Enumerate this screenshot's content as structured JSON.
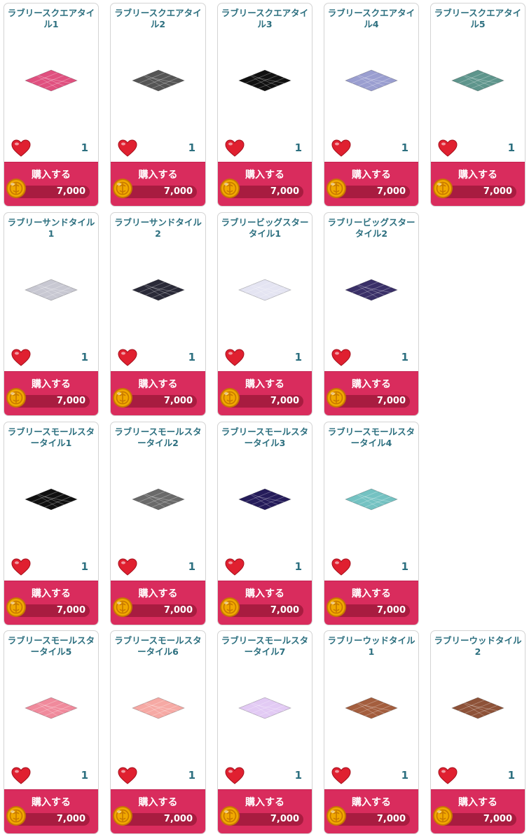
{
  "buy_label": "購入する",
  "colors": {
    "title": "#2c6f7f",
    "buy_panel": "#d92c5d",
    "price_bar": "#a81c40",
    "heart": "#e02030",
    "coin": "#f0a800"
  },
  "items": [
    {
      "name": "ラブリースクエアタイル1",
      "likes": "1",
      "price": "7,000",
      "icon": "pink-square-tile-icon",
      "tile_color": "#e0507f"
    },
    {
      "name": "ラブリースクエアタイル2",
      "likes": "1",
      "price": "7,000",
      "icon": "gray-square-tile-icon",
      "tile_color": "#555555"
    },
    {
      "name": "ラブリースクエアタイル3",
      "likes": "1",
      "price": "7,000",
      "icon": "black-square-tile-icon",
      "tile_color": "#111111"
    },
    {
      "name": "ラブリースクエアタイル4",
      "likes": "1",
      "price": "7,000",
      "icon": "lavender-square-tile-icon",
      "tile_color": "#9a9ed0"
    },
    {
      "name": "ラブリースクエアタイル5",
      "likes": "1",
      "price": "7,000",
      "icon": "teal-square-tile-icon",
      "tile_color": "#5e958c"
    },
    {
      "name": "ラブリーサンドタイル1",
      "likes": "1",
      "price": "7,000",
      "icon": "silver-sand-tile-icon",
      "tile_color": "#c8c8d2"
    },
    {
      "name": "ラブリーサンドタイル2",
      "likes": "1",
      "price": "7,000",
      "icon": "dark-sand-tile-icon",
      "tile_color": "#2a2a38"
    },
    {
      "name": "ラブリービッグスタータイル1",
      "likes": "1",
      "price": "7,000",
      "icon": "white-big-star-tile-icon",
      "tile_color": "#e4e4f2"
    },
    {
      "name": "ラブリービッグスタータイル2",
      "likes": "1",
      "price": "7,000",
      "icon": "purple-big-star-tile-icon",
      "tile_color": "#3a3068"
    },
    {
      "name": "ラブリースモールスタータイル1",
      "likes": "1",
      "price": "7,000",
      "icon": "black-small-star-tile-icon",
      "tile_color": "#111111"
    },
    {
      "name": "ラブリースモールスタータイル2",
      "likes": "1",
      "price": "7,000",
      "icon": "gray-small-star-tile-icon",
      "tile_color": "#6a6a6a"
    },
    {
      "name": "ラブリースモールスタータイル3",
      "likes": "1",
      "price": "7,000",
      "icon": "navy-small-star-tile-icon",
      "tile_color": "#251c5a"
    },
    {
      "name": "ラブリースモールスタータイル4",
      "likes": "1",
      "price": "7,000",
      "icon": "aqua-small-star-tile-icon",
      "tile_color": "#74c2c2"
    },
    {
      "name": "ラブリースモールスタータイル5",
      "likes": "1",
      "price": "7,000",
      "icon": "pink-small-star-tile-icon",
      "tile_color": "#f08a9c"
    },
    {
      "name": "ラブリースモールスタータイル6",
      "likes": "1",
      "price": "7,000",
      "icon": "peach-small-star-tile-icon",
      "tile_color": "#f6a9a4"
    },
    {
      "name": "ラブリースモールスタータイル7",
      "likes": "1",
      "price": "7,000",
      "icon": "lilac-small-star-tile-icon",
      "tile_color": "#e2caf4"
    },
    {
      "name": "ラブリーウッドタイル1",
      "likes": "1",
      "price": "7,000",
      "icon": "wood-tile-icon",
      "tile_color": "#a45e3e"
    },
    {
      "name": "ラブリーウッドタイル2",
      "likes": "1",
      "price": "7,000",
      "icon": "wood-tile-icon",
      "tile_color": "#8e5238"
    }
  ]
}
